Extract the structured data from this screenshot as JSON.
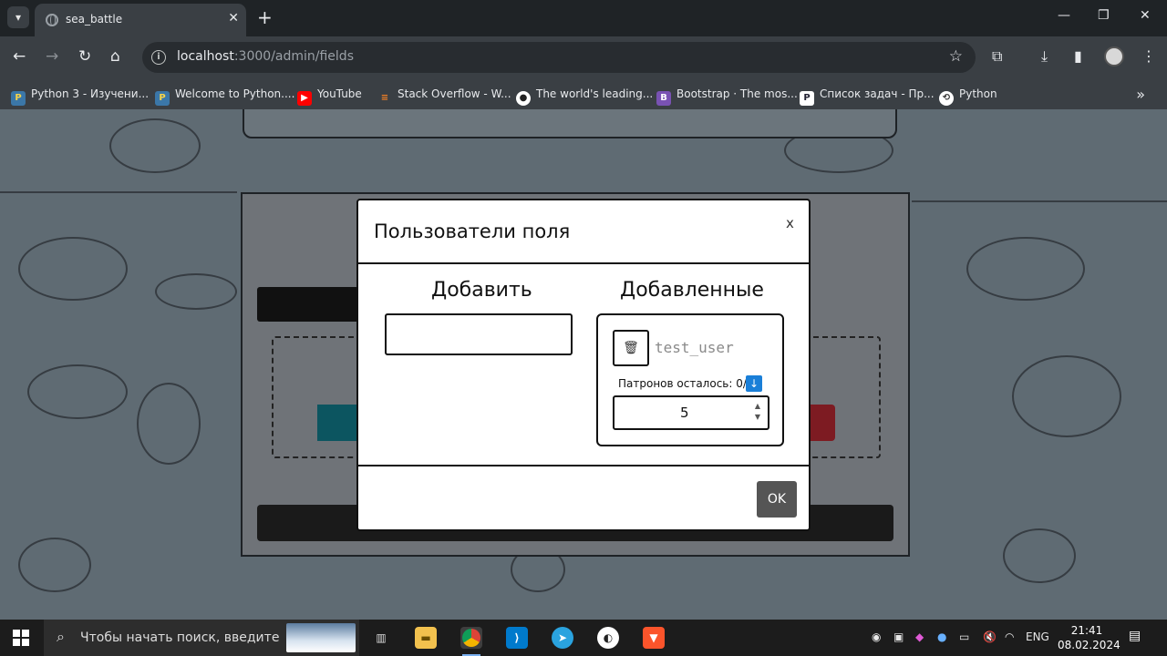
{
  "browser": {
    "tab_title": "sea_battle",
    "tab_close": "✕",
    "new_tab": "+",
    "url_host": "localhost",
    "url_rest": ":3000/admin/fields",
    "window_controls": [
      "—",
      "❐",
      "✕"
    ],
    "icons": [
      "back-icon",
      "forward-icon",
      "reload-icon",
      "home-icon",
      "star-icon",
      "extensions-icon",
      "download-icon",
      "sidepanel-icon",
      "menu-icon"
    ]
  },
  "bookmarks": [
    {
      "label": "Python 3 - Изучени...",
      "icon": "P",
      "color": "#3b77a8"
    },
    {
      "label": "Welcome to Python....",
      "icon": "P",
      "color": "#3b77a8"
    },
    {
      "label": "YouTube",
      "icon": "▶",
      "color": "#ff0000"
    },
    {
      "label": "Stack Overflow - W...",
      "icon": "S",
      "color": "#f48024"
    },
    {
      "label": "The world's leading...",
      "icon": "G",
      "color": "#ffffff"
    },
    {
      "label": "Bootstrap · The mos...",
      "icon": "B",
      "color": "#7952b3"
    },
    {
      "label": "Список задач - Пр...",
      "icon": "P",
      "color": "#ffffff"
    },
    {
      "label": "Python",
      "icon": "P",
      "color": "#ffffff"
    }
  ],
  "modal": {
    "title": "Пользователи поля",
    "close": "x",
    "add_heading": "Добавить",
    "added_heading": "Добавленные",
    "add_input_value": "",
    "username": "test_user",
    "ammo_label": "Патронов осталось: 0/",
    "ammo_icon": "↓",
    "ammo_value": "5",
    "ok_label": "OK"
  },
  "taskbar": {
    "search_placeholder": "Чтобы начать поиск, введите",
    "language": "ENG",
    "time": "21:41",
    "date": "08.02.2024",
    "apps": [
      "task-view-icon",
      "file-explorer-icon",
      "chrome-icon",
      "vscode-icon",
      "telegram-icon",
      "game-icon",
      "brave-icon"
    ]
  }
}
